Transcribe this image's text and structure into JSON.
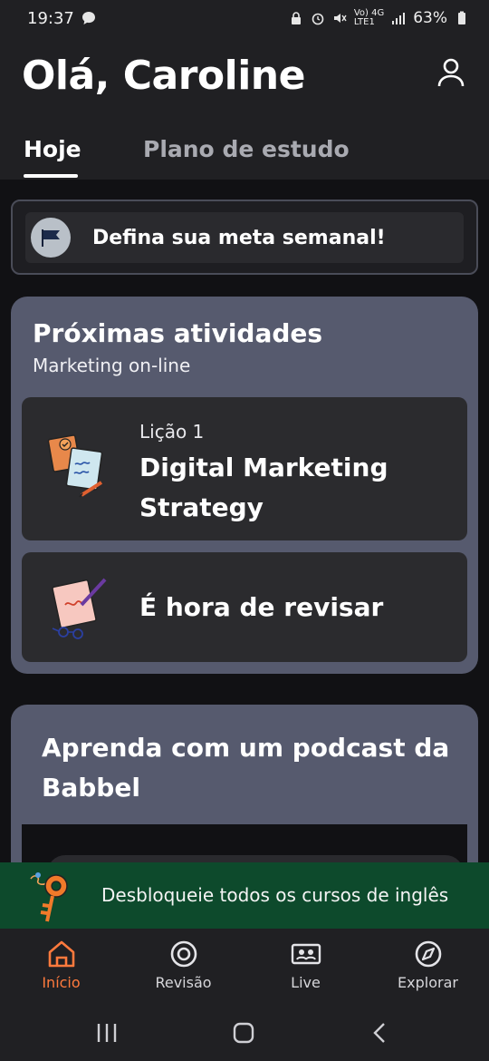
{
  "status_bar": {
    "time": "19:37",
    "network": "Vo) 4G\nLTE1",
    "battery": "63%"
  },
  "header": {
    "greeting": "Olá, Caroline",
    "tabs": [
      {
        "label": "Hoje",
        "active": true
      },
      {
        "label": "Plano de estudo",
        "active": false
      }
    ]
  },
  "goal_banner": {
    "text": "Defina sua meta semanal!",
    "icon": "flag-icon"
  },
  "next_activities": {
    "title": "Próximas atividades",
    "course": "Marketing on-line",
    "items": [
      {
        "kicker": "Lição 1",
        "title": "Digital Marketing Strategy",
        "icon": "lesson-illustration-icon"
      },
      {
        "title": "É hora de revisar",
        "icon": "review-illustration-icon"
      }
    ]
  },
  "podcast": {
    "title": "Aprenda com um podcast da Babbel"
  },
  "promo_banner": {
    "text": "Desbloqueie todos os cursos de inglês",
    "icon": "key-icon"
  },
  "bottom_nav": {
    "items": [
      {
        "label": "Início",
        "icon": "home-icon",
        "active": true
      },
      {
        "label": "Revisão",
        "icon": "target-icon",
        "active": false
      },
      {
        "label": "Live",
        "icon": "live-icon",
        "active": false
      },
      {
        "label": "Explorar",
        "icon": "compass-icon",
        "active": false
      }
    ]
  },
  "colors": {
    "accent": "#ff7a3d",
    "card": "#565a6e",
    "promo": "#0d4a2c",
    "background": "#111114"
  }
}
